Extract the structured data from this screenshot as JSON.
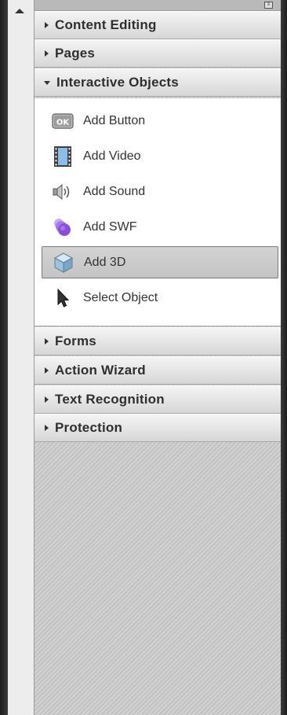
{
  "sections_top": [
    {
      "label": "Content Editing"
    },
    {
      "label": "Pages"
    },
    {
      "label": "Interactive Objects"
    }
  ],
  "tools": [
    {
      "label": "Add Button",
      "icon": "ok-button-icon",
      "icon_text": "OK"
    },
    {
      "label": "Add Video",
      "icon": "film-icon"
    },
    {
      "label": "Add Sound",
      "icon": "speaker-icon"
    },
    {
      "label": "Add SWF",
      "icon": "swf-icon"
    },
    {
      "label": "Add 3D",
      "icon": "cube-3d-icon",
      "selected": true
    },
    {
      "label": "Select Object",
      "icon": "cursor-arrow-icon"
    }
  ],
  "sections_bottom": [
    {
      "label": "Forms"
    },
    {
      "label": "Action Wizard"
    },
    {
      "label": "Text Recognition"
    },
    {
      "label": "Protection"
    }
  ],
  "colors": {
    "accent_purple": "#8a4fd8",
    "selected_bg": "#c8c8c8"
  }
}
